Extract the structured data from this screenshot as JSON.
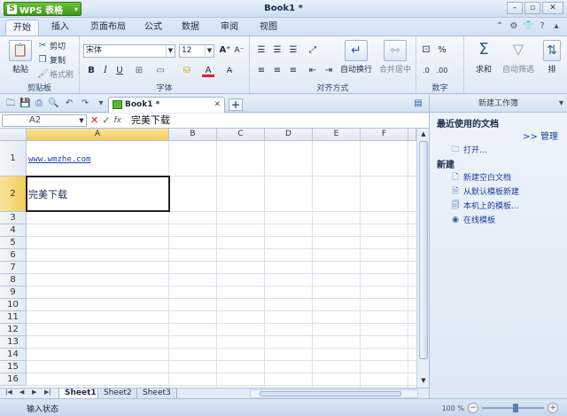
{
  "app": {
    "button_label": "WPS 表格",
    "title": "Book1 *"
  },
  "tabs": [
    "开始",
    "插入",
    "页面布局",
    "公式",
    "数据",
    "审阅",
    "视图"
  ],
  "ribbon": {
    "clipboard": {
      "paste": "粘贴",
      "cut": "剪切",
      "copy": "复制",
      "format_painter": "格式刷",
      "label": "剪贴板"
    },
    "font": {
      "name": "宋体",
      "size": "12",
      "bold": "B",
      "italic": "I",
      "underline": "U",
      "label": "字体"
    },
    "align": {
      "wrap": "自动换行",
      "merge": "合并居中",
      "label": "对齐方式"
    },
    "number": {
      "percent": "%",
      "label": "数字"
    },
    "edit": {
      "sum": "求和",
      "filter": "自动筛选",
      "sort": "排"
    }
  },
  "doc_tab": {
    "name": "Book1 *"
  },
  "formula_bar": {
    "cell_ref": "A2",
    "value": "完美下载"
  },
  "grid": {
    "columns": [
      "A",
      "B",
      "C",
      "D",
      "E",
      "F"
    ],
    "rows": [
      "1",
      "2",
      "3",
      "4",
      "5",
      "6",
      "7",
      "8",
      "9",
      "10",
      "11",
      "12",
      "13",
      "14",
      "15",
      "16"
    ],
    "a1": "www.wmzhe.com",
    "a2": "完美下载"
  },
  "sheets": [
    "Sheet1",
    "Sheet2",
    "Sheet3"
  ],
  "taskpane": {
    "title": "新建工作簿",
    "recent_heading": "最近使用的文档",
    "manage": ">> 管理",
    "open": "打开...",
    "new_heading": "新建",
    "new_items": [
      "新建空白文档",
      "从默认模板新建",
      "本机上的模板...",
      "在线模板"
    ]
  },
  "status": {
    "mode": "输入状态",
    "zoom": "100 %"
  },
  "colors": {
    "accent_green": "#3d9718",
    "selection_header": "#f2cc58",
    "link": "#1a3fb8"
  }
}
